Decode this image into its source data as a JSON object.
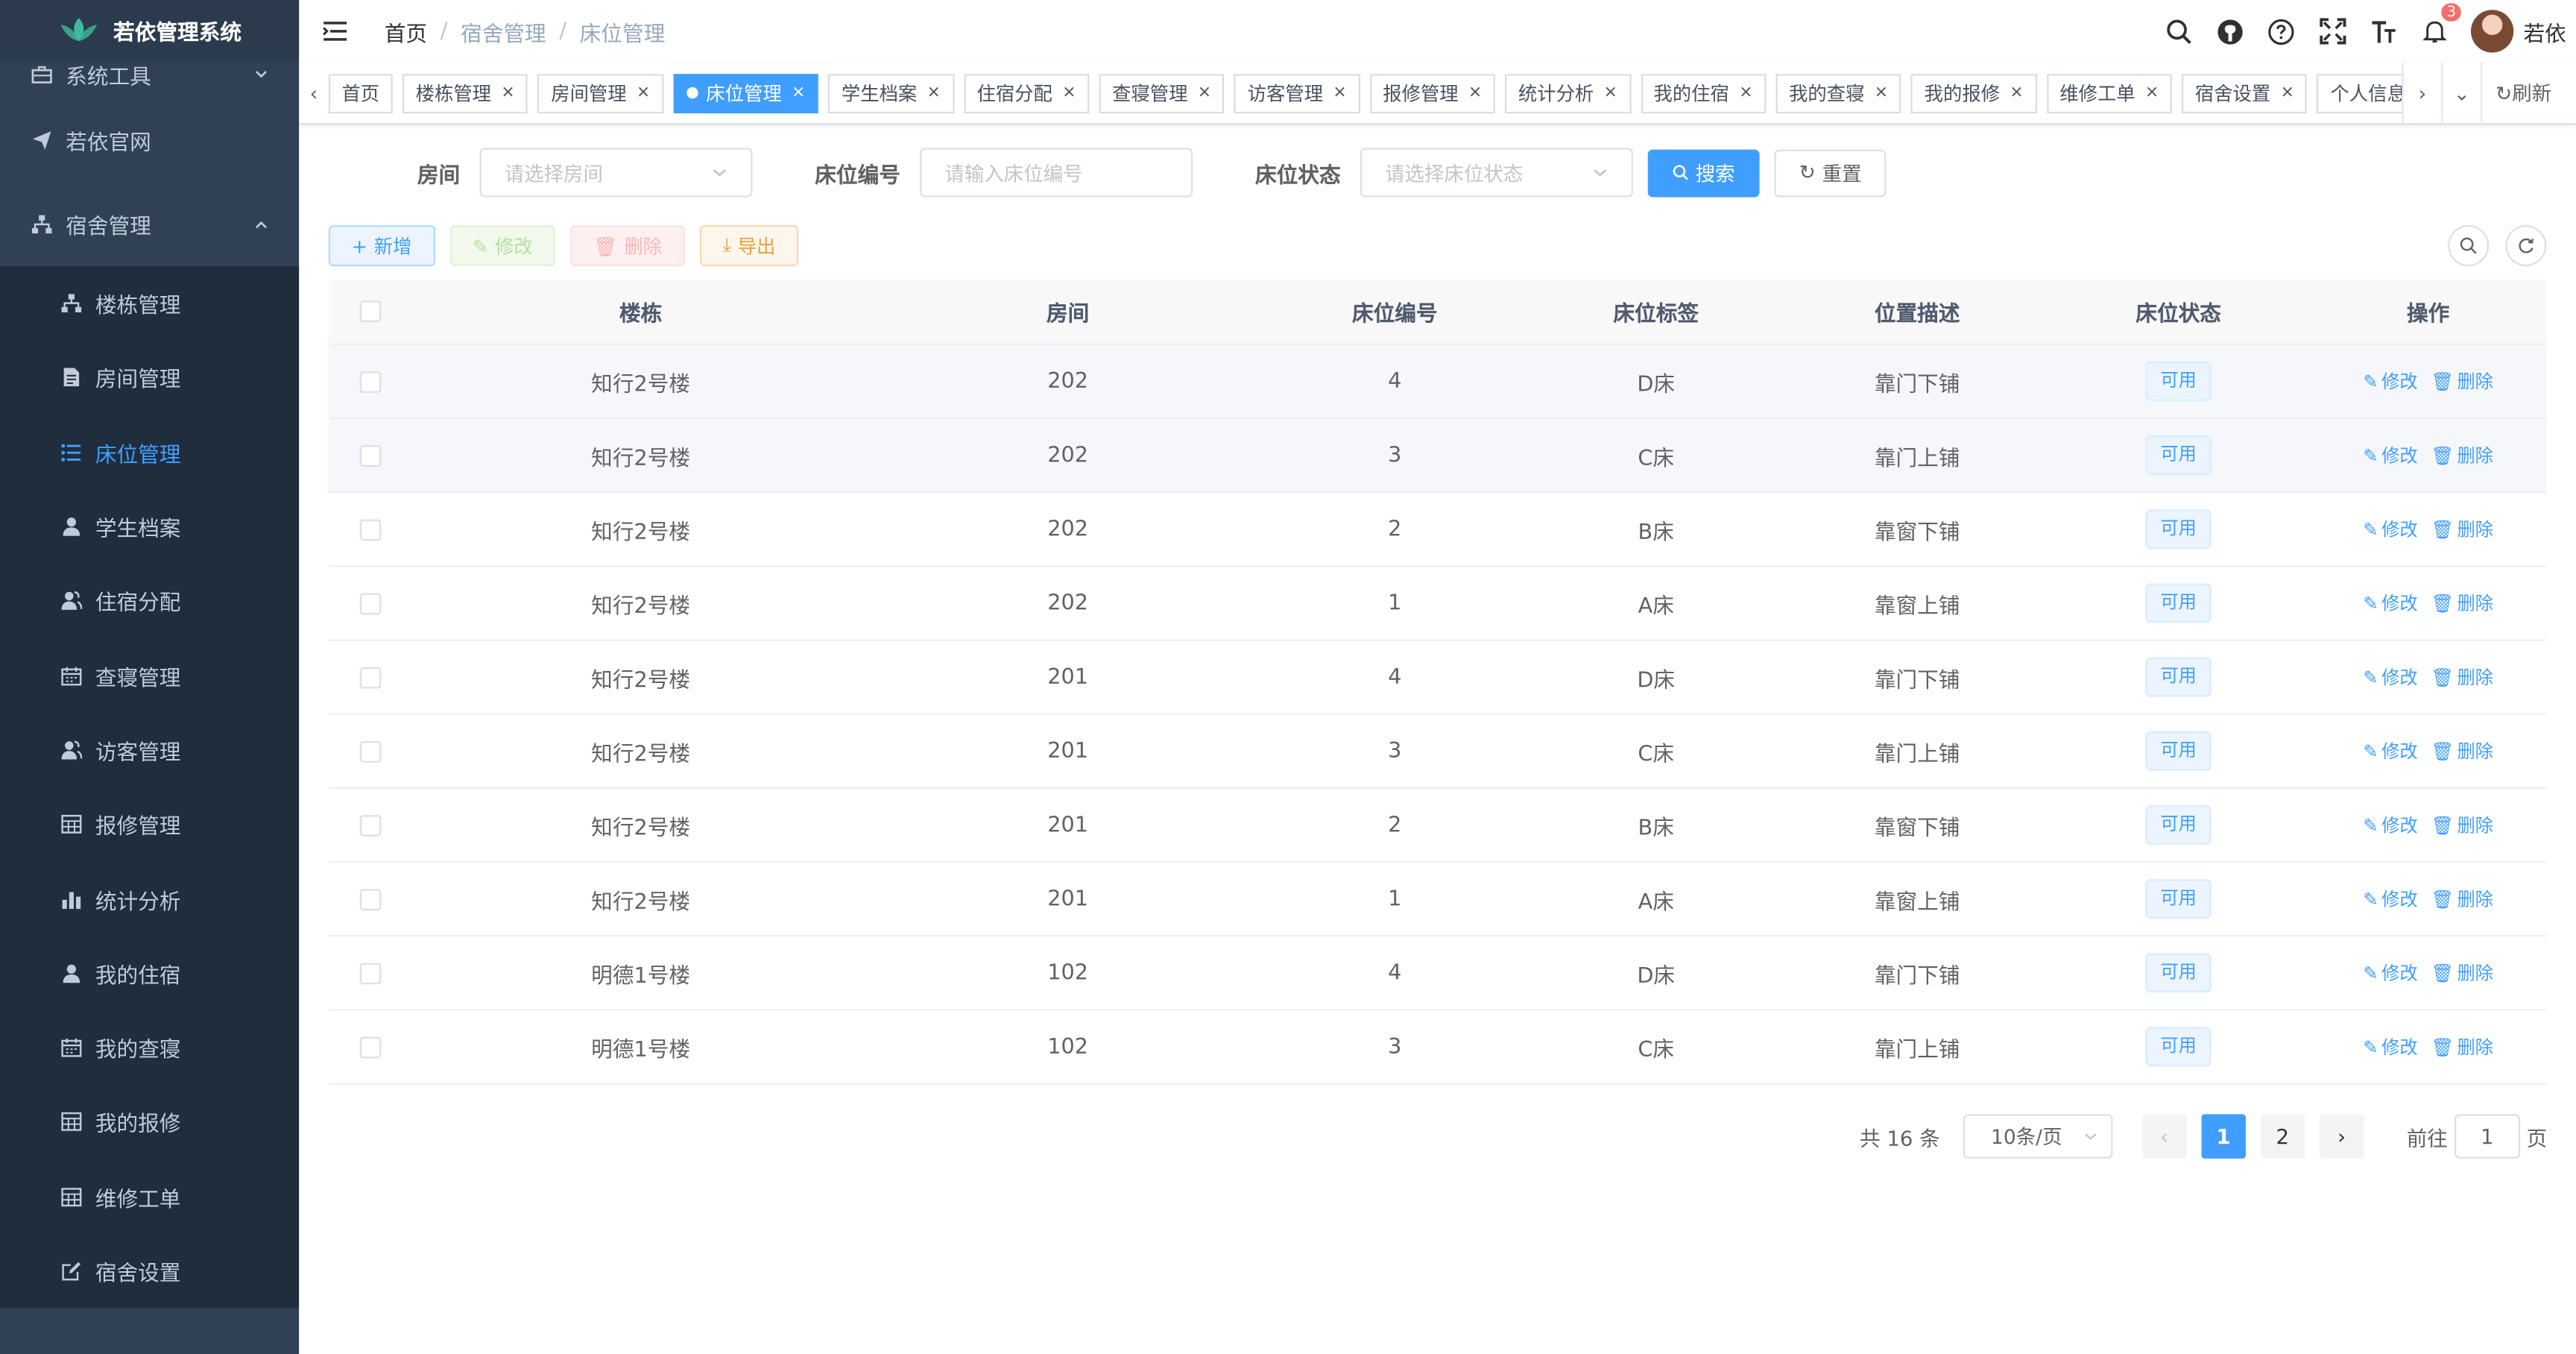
{
  "app": {
    "title": "若依管理系统"
  },
  "sidebar": {
    "items": [
      {
        "label": "系统工具",
        "icon": "toolbox-icon"
      },
      {
        "label": "若依官网",
        "icon": "send-icon"
      },
      {
        "label": "宿舍管理",
        "icon": "tree-icon"
      }
    ],
    "sub_items": [
      {
        "label": "楼栋管理",
        "icon": "tree-icon"
      },
      {
        "label": "房间管理",
        "icon": "document-icon"
      },
      {
        "label": "床位管理",
        "icon": "list-icon",
        "active": true
      },
      {
        "label": "学生档案",
        "icon": "user-icon"
      },
      {
        "label": "住宿分配",
        "icon": "peoples-icon"
      },
      {
        "label": "查寝管理",
        "icon": "date-icon"
      },
      {
        "label": "访客管理",
        "icon": "peoples-icon"
      },
      {
        "label": "报修管理",
        "icon": "table-icon"
      },
      {
        "label": "统计分析",
        "icon": "chart-icon"
      },
      {
        "label": "我的住宿",
        "icon": "user-icon"
      },
      {
        "label": "我的查寝",
        "icon": "date-icon"
      },
      {
        "label": "我的报修",
        "icon": "table-icon"
      },
      {
        "label": "维修工单",
        "icon": "table-icon"
      },
      {
        "label": "宿舍设置",
        "icon": "edit-icon"
      }
    ]
  },
  "breadcrumb": [
    "首页",
    "宿舍管理",
    "床位管理"
  ],
  "navbar": {
    "user": "若依",
    "notification_count": "3"
  },
  "tags": [
    {
      "label": "首页",
      "closable": false
    },
    {
      "label": "楼栋管理",
      "closable": true
    },
    {
      "label": "房间管理",
      "closable": true
    },
    {
      "label": "床位管理",
      "closable": true,
      "active": true
    },
    {
      "label": "学生档案",
      "closable": true
    },
    {
      "label": "住宿分配",
      "closable": true
    },
    {
      "label": "查寝管理",
      "closable": true
    },
    {
      "label": "访客管理",
      "closable": true
    },
    {
      "label": "报修管理",
      "closable": true
    },
    {
      "label": "统计分析",
      "closable": true
    },
    {
      "label": "我的住宿",
      "closable": true
    },
    {
      "label": "我的查寝",
      "closable": true
    },
    {
      "label": "我的报修",
      "closable": true
    },
    {
      "label": "维修工单",
      "closable": true
    },
    {
      "label": "宿舍设置",
      "closable": true
    },
    {
      "label": "个人信息",
      "closable": false
    }
  ],
  "tags_refresh": "刷新",
  "search": {
    "room_label": "房间",
    "room_placeholder": "请选择房间",
    "bed_no_label": "床位编号",
    "bed_no_placeholder": "请输入床位编号",
    "status_label": "床位状态",
    "status_placeholder": "请选择床位状态",
    "search_btn": "搜索",
    "reset_btn": "重置"
  },
  "toolbar": {
    "add": "新增",
    "edit": "修改",
    "delete": "删除",
    "export": "导出"
  },
  "table": {
    "columns": [
      "楼栋",
      "房间",
      "床位编号",
      "床位标签",
      "位置描述",
      "床位状态",
      "操作"
    ],
    "rows": [
      {
        "building": "知行2号楼",
        "room": "202",
        "bed_no": "4",
        "tag": "D床",
        "position": "靠门下铺",
        "status": "可用"
      },
      {
        "building": "知行2号楼",
        "room": "202",
        "bed_no": "3",
        "tag": "C床",
        "position": "靠门上铺",
        "status": "可用"
      },
      {
        "building": "知行2号楼",
        "room": "202",
        "bed_no": "2",
        "tag": "B床",
        "position": "靠窗下铺",
        "status": "可用"
      },
      {
        "building": "知行2号楼",
        "room": "202",
        "bed_no": "1",
        "tag": "A床",
        "position": "靠窗上铺",
        "status": "可用"
      },
      {
        "building": "知行2号楼",
        "room": "201",
        "bed_no": "4",
        "tag": "D床",
        "position": "靠门下铺",
        "status": "可用"
      },
      {
        "building": "知行2号楼",
        "room": "201",
        "bed_no": "3",
        "tag": "C床",
        "position": "靠门上铺",
        "status": "可用"
      },
      {
        "building": "知行2号楼",
        "room": "201",
        "bed_no": "2",
        "tag": "B床",
        "position": "靠窗下铺",
        "status": "可用"
      },
      {
        "building": "知行2号楼",
        "room": "201",
        "bed_no": "1",
        "tag": "A床",
        "position": "靠窗上铺",
        "status": "可用"
      },
      {
        "building": "明德1号楼",
        "room": "102",
        "bed_no": "4",
        "tag": "D床",
        "position": "靠门下铺",
        "status": "可用"
      },
      {
        "building": "明德1号楼",
        "room": "102",
        "bed_no": "3",
        "tag": "C床",
        "position": "靠门上铺",
        "status": "可用"
      }
    ],
    "op_edit": "修改",
    "op_delete": "删除"
  },
  "pagination": {
    "total_text": "共 16 条",
    "page_size": "10条/页",
    "pages": [
      "1",
      "2"
    ],
    "current": "1",
    "goto_label": "前往",
    "goto_value": "1",
    "goto_suffix": "页"
  },
  "colors": {
    "primary": "#409eff",
    "sidebar_bg": "#304156",
    "submenu_bg": "#1f2d3d",
    "danger": "#f56c6c"
  }
}
